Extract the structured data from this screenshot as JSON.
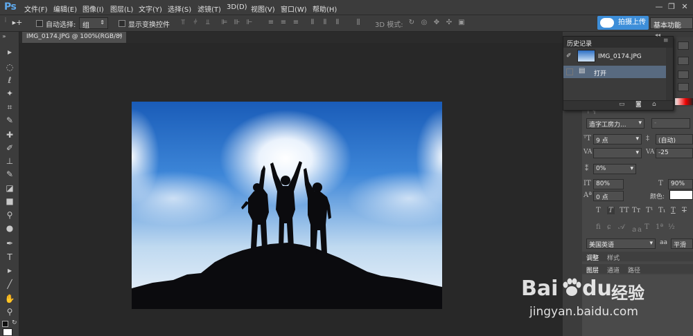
{
  "menubar": {
    "logo": "Ps",
    "items": [
      "文件(F)",
      "编辑(E)",
      "图像(I)",
      "图层(L)",
      "文字(Y)",
      "选择(S)",
      "滤镜(T)",
      "3D(D)",
      "视图(V)",
      "窗口(W)",
      "帮助(H)"
    ],
    "window_controls": [
      "—",
      "❐",
      "✕"
    ]
  },
  "options": {
    "auto_select_label": "自动选择:",
    "auto_select_value": "组",
    "show_transform_label": "显示变换控件",
    "mode_3d_label": "3D 模式:"
  },
  "upload_button": "拍摄上传",
  "workspace": "基本功能",
  "document_tab": {
    "title": "IMG_0174.JPG @ 100%(RGB/8)",
    "close": "×"
  },
  "history_panel": {
    "title": "历史记录",
    "snapshot_name": "IMG_0174.JPG",
    "steps": [
      "打开"
    ]
  },
  "character_panel": {
    "font_family": "造字工房力...",
    "font_style": "-",
    "font_size": "9 点",
    "leading": "(自动)",
    "kerning": "",
    "tracking": "-25",
    "vertical_scale_pct": "0%",
    "horizontal_scale_left": "80%",
    "horizontal_scale_right": "90%",
    "baseline_shift": "0 点",
    "color_label": "颜色:",
    "language": "美国英语",
    "antialias": "平滑",
    "aa_icon": "aa"
  },
  "adjust_panel": {
    "tabs": [
      "调整",
      "样式"
    ],
    "subtabs": [
      "图层",
      "通道",
      "路径"
    ]
  },
  "watermark": {
    "brand": "Bai",
    "brand2": "du",
    "cn": "经验",
    "url": "jingyan.baidu.com"
  },
  "colors": {
    "ui_dark": "#3c3c3c",
    "canvas_bg": "#282828",
    "accent": "#3d8ed9",
    "ps_blue": "#5fa9ec"
  }
}
